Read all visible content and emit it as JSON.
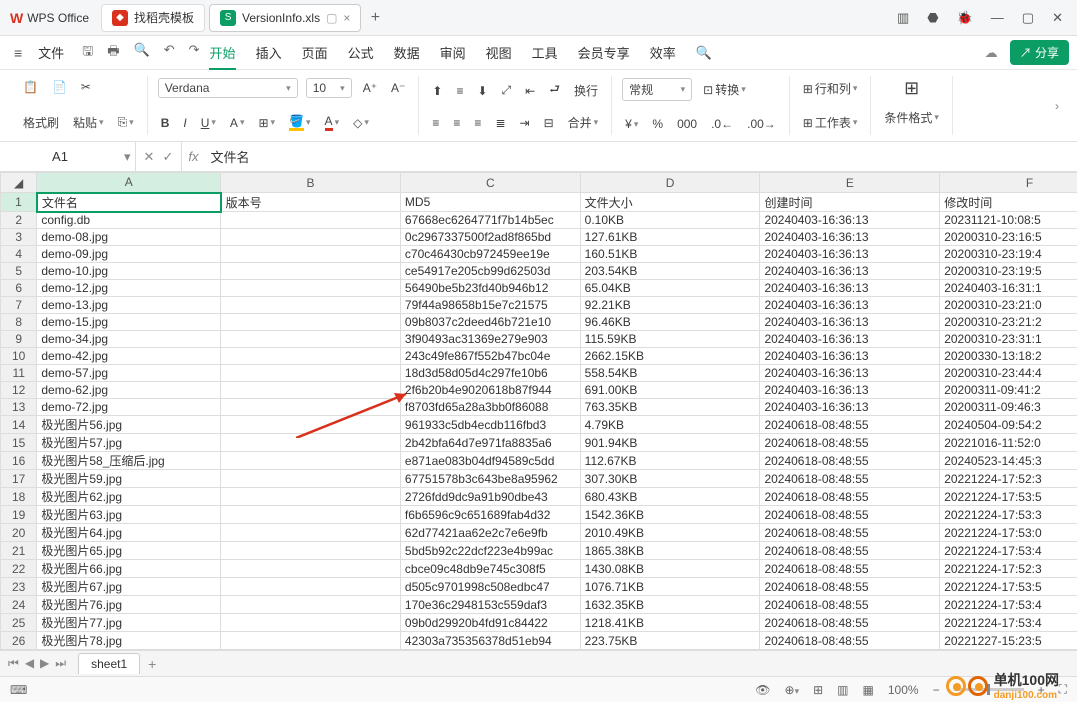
{
  "titlebar": {
    "app": "WPS Office",
    "template_tab": "找稻壳模板",
    "active_tab": "VersionInfo.xls",
    "newtab": "+"
  },
  "menubar": {
    "file": "文件",
    "items": [
      "开始",
      "插入",
      "页面",
      "公式",
      "数据",
      "审阅",
      "视图",
      "工具",
      "会员专享",
      "效率"
    ],
    "share": "分享"
  },
  "toolbar": {
    "format_brush": "格式刷",
    "paste": "粘贴",
    "font": "Verdana",
    "size": "10",
    "wrap": "换行",
    "merge": "合并",
    "general": "常规",
    "convert": "转换",
    "rowcol": "行和列",
    "worksheet": "工作表",
    "condfmt": "条件格式"
  },
  "fxbar": {
    "cell": "A1",
    "formula": "文件名"
  },
  "columns": [
    "A",
    "B",
    "C",
    "D",
    "E",
    "F"
  ],
  "headers": {
    "A": "文件名",
    "B": "版本号",
    "C": "MD5",
    "D": "文件大小",
    "E": "创建时间",
    "F": "修改时间"
  },
  "rows": [
    {
      "n": 1,
      "A": "文件名",
      "B": "版本号",
      "C": "MD5",
      "D": "文件大小",
      "E": "创建时间",
      "F": "修改时间"
    },
    {
      "n": 2,
      "A": "config.db",
      "B": "",
      "C": "67668ec6264771f7b14b5ec",
      "D": "0.10KB",
      "E": "20240403-16:36:13",
      "F": "20231121-10:08:5"
    },
    {
      "n": 3,
      "A": "demo-08.jpg",
      "B": "",
      "C": "0c2967337500f2ad8f865bd",
      "D": "127.61KB",
      "E": "20240403-16:36:13",
      "F": "20200310-23:16:5"
    },
    {
      "n": 4,
      "A": "demo-09.jpg",
      "B": "",
      "C": "c70c46430cb972459ee19e",
      "D": "160.51KB",
      "E": "20240403-16:36:13",
      "F": "20200310-23:19:4"
    },
    {
      "n": 5,
      "A": "demo-10.jpg",
      "B": "",
      "C": "ce54917e205cb99d62503d",
      "D": "203.54KB",
      "E": "20240403-16:36:13",
      "F": "20200310-23:19:5"
    },
    {
      "n": 6,
      "A": "demo-12.jpg",
      "B": "",
      "C": "56490be5b23fd40b946b12",
      "D": "65.04KB",
      "E": "20240403-16:36:13",
      "F": "20240403-16:31:1"
    },
    {
      "n": 7,
      "A": "demo-13.jpg",
      "B": "",
      "C": "79f44a98658b15e7c21575",
      "D": "92.21KB",
      "E": "20240403-16:36:13",
      "F": "20200310-23:21:0"
    },
    {
      "n": 8,
      "A": "demo-15.jpg",
      "B": "",
      "C": "09b8037c2deed46b721e10",
      "D": "96.46KB",
      "E": "20240403-16:36:13",
      "F": "20200310-23:21:2"
    },
    {
      "n": 9,
      "A": "demo-34.jpg",
      "B": "",
      "C": "3f90493ac31369e279e903",
      "D": "115.59KB",
      "E": "20240403-16:36:13",
      "F": "20200310-23:31:1"
    },
    {
      "n": 10,
      "A": "demo-42.jpg",
      "B": "",
      "C": "243c49fe867f552b47bc04e",
      "D": "2662.15KB",
      "E": "20240403-16:36:13",
      "F": "20200330-13:18:2"
    },
    {
      "n": 11,
      "A": "demo-57.jpg",
      "B": "",
      "C": "18d3d58d05d4c297fe10b6",
      "D": "558.54KB",
      "E": "20240403-16:36:13",
      "F": "20200310-23:44:4"
    },
    {
      "n": 12,
      "A": "demo-62.jpg",
      "B": "",
      "C": "2f6b20b4e9020618b87f944",
      "D": "691.00KB",
      "E": "20240403-16:36:13",
      "F": "20200311-09:41:2"
    },
    {
      "n": 13,
      "A": "demo-72.jpg",
      "B": "",
      "C": "f8703fd65a28a3bb0f86088",
      "D": "763.35KB",
      "E": "20240403-16:36:13",
      "F": "20200311-09:46:3"
    },
    {
      "n": 14,
      "A": "极光图片56.jpg",
      "B": "",
      "C": "961933c5db4ecdb116fbd3",
      "D": "4.79KB",
      "E": "20240618-08:48:55",
      "F": "20240504-09:54:2"
    },
    {
      "n": 15,
      "A": "极光图片57.jpg",
      "B": "",
      "C": "2b42bfa64d7e971fa8835a6",
      "D": "901.94KB",
      "E": "20240618-08:48:55",
      "F": "20221016-11:52:0"
    },
    {
      "n": 16,
      "A": "极光图片58_压缩后.jpg",
      "B": "",
      "C": "e871ae083b04df94589c5dd",
      "D": "112.67KB",
      "E": "20240618-08:48:55",
      "F": "20240523-14:45:3"
    },
    {
      "n": 17,
      "A": "极光图片59.jpg",
      "B": "",
      "C": "67751578b3c643be8a95962",
      "D": "307.30KB",
      "E": "20240618-08:48:55",
      "F": "20221224-17:52:3"
    },
    {
      "n": 18,
      "A": "极光图片62.jpg",
      "B": "",
      "C": "2726fdd9dc9a91b90dbe43",
      "D": "680.43KB",
      "E": "20240618-08:48:55",
      "F": "20221224-17:53:5"
    },
    {
      "n": 19,
      "A": "极光图片63.jpg",
      "B": "",
      "C": "f6b6596c9c651689fab4d32",
      "D": "1542.36KB",
      "E": "20240618-08:48:55",
      "F": "20221224-17:53:3"
    },
    {
      "n": 20,
      "A": "极光图片64.jpg",
      "B": "",
      "C": "62d77421aa62e2c7e6e9fb",
      "D": "2010.49KB",
      "E": "20240618-08:48:55",
      "F": "20221224-17:53:0"
    },
    {
      "n": 21,
      "A": "极光图片65.jpg",
      "B": "",
      "C": "5bd5b92c22dcf223e4b99ac",
      "D": "1865.38KB",
      "E": "20240618-08:48:55",
      "F": "20221224-17:53:4"
    },
    {
      "n": 22,
      "A": "极光图片66.jpg",
      "B": "",
      "C": "cbce09c48db9e745c308f5",
      "D": "1430.08KB",
      "E": "20240618-08:48:55",
      "F": "20221224-17:52:3"
    },
    {
      "n": 23,
      "A": "极光图片67.jpg",
      "B": "",
      "C": "d505c9701998c508edbc47",
      "D": "1076.71KB",
      "E": "20240618-08:48:55",
      "F": "20221224-17:53:5"
    },
    {
      "n": 24,
      "A": "极光图片76.jpg",
      "B": "",
      "C": "170e36c2948153c559daf3",
      "D": "1632.35KB",
      "E": "20240618-08:48:55",
      "F": "20221224-17:53:4"
    },
    {
      "n": 25,
      "A": "极光图片77.jpg",
      "B": "",
      "C": "09b0d29920b4fd91c84422",
      "D": "1218.41KB",
      "E": "20240618-08:48:55",
      "F": "20221224-17:53:4"
    },
    {
      "n": 26,
      "A": "极光图片78.jpg",
      "B": "",
      "C": "42303a735356378d51eb94",
      "D": "223.75KB",
      "E": "20240618-08:48:55",
      "F": "20221227-15:23:5"
    }
  ],
  "sheettab": "sheet1",
  "status": {
    "zoom": "100%"
  },
  "watermark": {
    "brand": "单机100网",
    "url": "danji100.com"
  }
}
